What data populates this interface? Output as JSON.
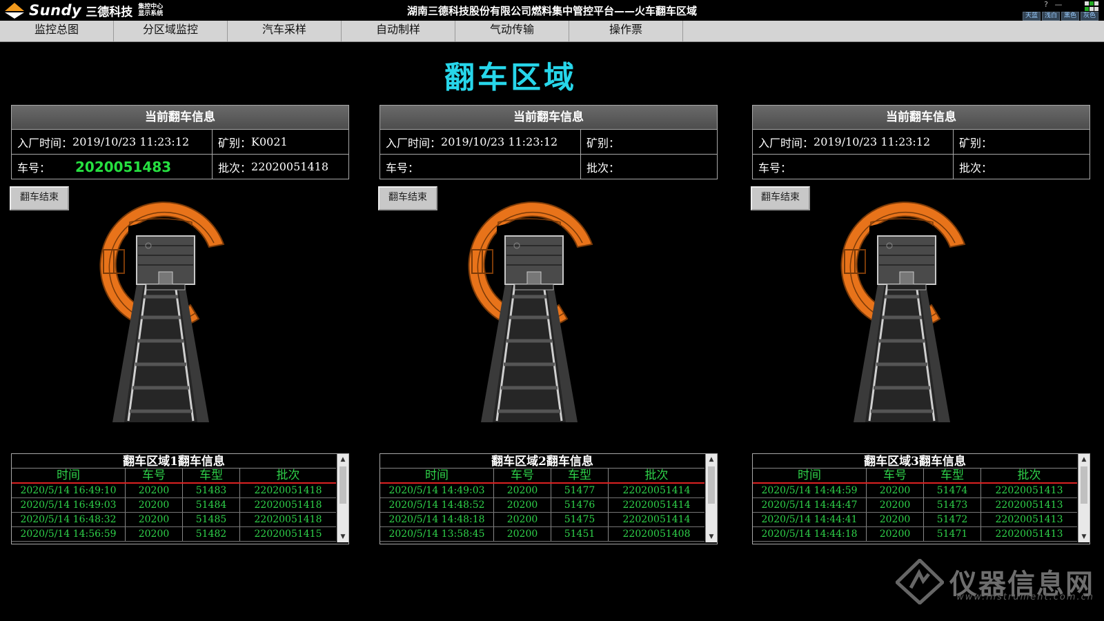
{
  "app": {
    "logo_text": "Sundy",
    "logo_cn": "三德科技",
    "logo_sub_1": "集控中心",
    "logo_sub_2": "显示系统",
    "title": "湖南三德科技股份有限公司燃料集中管控平台——火车翻车区域",
    "theme_options": [
      "天蓝",
      "浅白",
      "黑色",
      "灰色"
    ],
    "window_controls": [
      "?",
      "—"
    ]
  },
  "menu": [
    "监控总图",
    "分区域监控",
    "汽车采样",
    "自动制样",
    "气动传输",
    "操作票"
  ],
  "page_title": "翻车区域",
  "panels": [
    {
      "info_header": "当前翻车信息",
      "entry_time_label": "入厂时间：",
      "entry_time": "2019/10/23 11:23:12",
      "mine_label": "矿别：",
      "mine": "K0021",
      "car_no_label": "车号：",
      "car_no": "2020051483",
      "batch_label": "批次：",
      "batch": "22020051418",
      "end_button": "翻车结束",
      "log_title": "翻车区域1翻车信息",
      "log_columns": [
        "时间",
        "车号",
        "车型",
        "批次"
      ],
      "log_rows": [
        [
          "2020/5/14 16:49:10",
          "20200",
          "51483",
          "22020051418"
        ],
        [
          "2020/5/14 16:49:03",
          "20200",
          "51484",
          "22020051418"
        ],
        [
          "2020/5/14 16:48:32",
          "20200",
          "51485",
          "22020051418"
        ],
        [
          "2020/5/14 14:56:59",
          "20200",
          "51482",
          "22020051415"
        ]
      ]
    },
    {
      "info_header": "当前翻车信息",
      "entry_time_label": "入厂时间：",
      "entry_time": "2019/10/23 11:23:12",
      "mine_label": "矿别：",
      "mine": "",
      "car_no_label": "车号：",
      "car_no": "",
      "batch_label": "批次：",
      "batch": "",
      "end_button": "翻车结束",
      "log_title": "翻车区域2翻车信息",
      "log_columns": [
        "时间",
        "车号",
        "车型",
        "批次"
      ],
      "log_rows": [
        [
          "2020/5/14 14:49:03",
          "20200",
          "51477",
          "22020051414"
        ],
        [
          "2020/5/14 14:48:52",
          "20200",
          "51476",
          "22020051414"
        ],
        [
          "2020/5/14 14:48:18",
          "20200",
          "51475",
          "22020051414"
        ],
        [
          "2020/5/14 13:58:45",
          "20200",
          "51451",
          "22020051408"
        ]
      ]
    },
    {
      "info_header": "当前翻车信息",
      "entry_time_label": "入厂时间：",
      "entry_time": "2019/10/23 11:23:12",
      "mine_label": "矿别：",
      "mine": "",
      "car_no_label": "车号：",
      "car_no": "",
      "batch_label": "批次：",
      "batch": "",
      "end_button": "翻车结束",
      "log_title": "翻车区域3翻车信息",
      "log_columns": [
        "时间",
        "车号",
        "车型",
        "批次"
      ],
      "log_rows": [
        [
          "2020/5/14 14:44:59",
          "20200",
          "51474",
          "22020051413"
        ],
        [
          "2020/5/14 14:44:47",
          "20200",
          "51473",
          "22020051413"
        ],
        [
          "2020/5/14 14:44:41",
          "20200",
          "51472",
          "22020051413"
        ],
        [
          "2020/5/14 14:44:18",
          "20200",
          "51471",
          "22020051413"
        ]
      ]
    }
  ],
  "watermark": {
    "text": "仪器信息网",
    "url": "www.instrument.com.cn"
  },
  "colors": {
    "title_cyan": "#27d6ea",
    "car_no_green": "#26e040",
    "log_green": "#2fd24a",
    "dumper_orange": "#e8731a"
  }
}
